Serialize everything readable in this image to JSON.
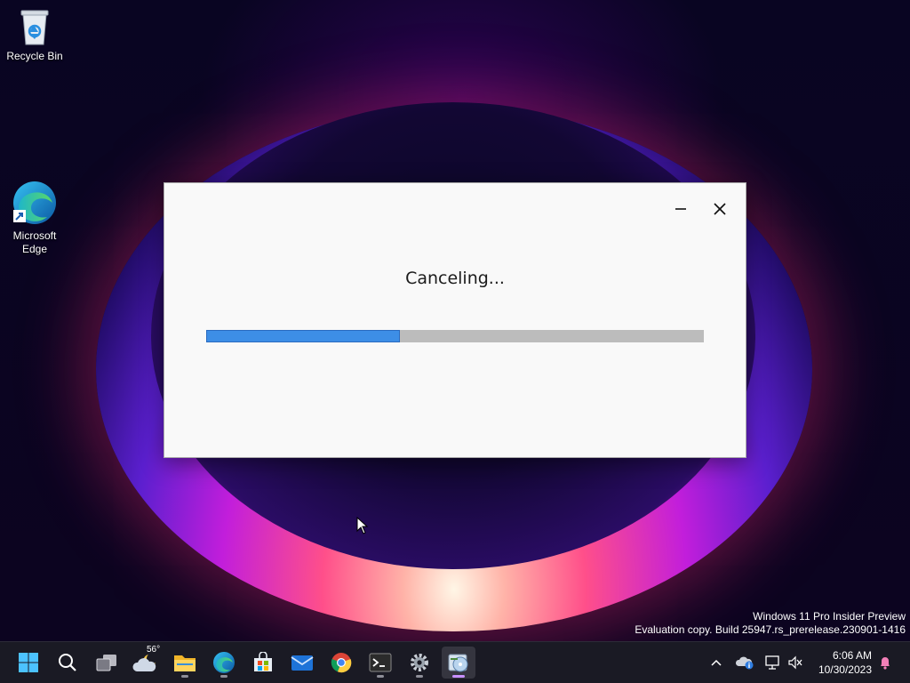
{
  "desktop": {
    "icons": [
      {
        "label": "Recycle Bin"
      },
      {
        "label": "Microsoft Edge"
      }
    ],
    "watermark": {
      "line1": "Windows 11 Pro Insider Preview",
      "line2": "Evaluation copy. Build 25947.rs_prerelease.230901-1416"
    }
  },
  "dialog": {
    "status_text": "Canceling...",
    "progress": 0.39,
    "buttons": {
      "minimize": "minimize-icon",
      "close": "close-icon"
    }
  },
  "taskbar": {
    "weather_temp": "56°",
    "apps": [
      "start",
      "search",
      "task-view",
      "widgets-weather",
      "file-explorer",
      "edge",
      "microsoft-store",
      "mail",
      "chrome",
      "terminal",
      "settings",
      "installer"
    ],
    "clock": {
      "time": "6:06 AM",
      "date": "10/30/2023"
    }
  },
  "colors": {
    "accent": "#3d8ee6",
    "taskbar": "#1a1a24",
    "dialog_bg": "#f9f9f9"
  }
}
